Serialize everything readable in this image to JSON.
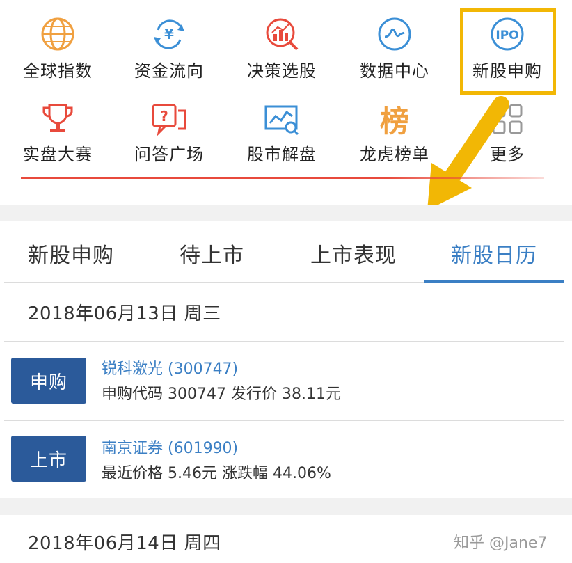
{
  "grid": {
    "row1": [
      {
        "label": "全球指数",
        "icon": "globe-icon"
      },
      {
        "label": "资金流向",
        "icon": "yen-flow-icon"
      },
      {
        "label": "决策选股",
        "icon": "decision-chart-icon"
      },
      {
        "label": "数据中心",
        "icon": "data-wave-icon"
      },
      {
        "label": "新股申购",
        "icon": "ipo-icon",
        "icon_text": "IPO"
      }
    ],
    "row2": [
      {
        "label": "实盘大赛",
        "icon": "trophy-icon"
      },
      {
        "label": "问答广场",
        "icon": "question-bubble-icon"
      },
      {
        "label": "股市解盘",
        "icon": "market-analysis-icon"
      },
      {
        "label": "龙虎榜单",
        "icon": "rank-list-icon",
        "icon_text": "榜"
      },
      {
        "label": "更多",
        "icon": "more-grid-icon"
      }
    ]
  },
  "tabs": [
    {
      "label": "新股申购",
      "active": false
    },
    {
      "label": "待上市",
      "active": false
    },
    {
      "label": "上市表现",
      "active": false
    },
    {
      "label": "新股日历",
      "active": true
    }
  ],
  "calendar": {
    "day1": {
      "date": "2018年06月13日 周三",
      "items": [
        {
          "badge": "申购",
          "name": "锐科激光 (300747)",
          "detail": "申购代码 300747 发行价 38.11元"
        },
        {
          "badge": "上市",
          "name": "南京证券 (601990)",
          "detail": "最近价格 5.46元 涨跌幅 44.06%"
        }
      ]
    },
    "day2": {
      "date": "2018年06月14日 周四"
    }
  },
  "watermark": "知乎 @Jane7",
  "colors": {
    "accent": "#3b7fc4",
    "badge": "#2b5a9a",
    "highlight": "#f2b705",
    "red": "#e84a3c",
    "orange": "#f0a040"
  }
}
